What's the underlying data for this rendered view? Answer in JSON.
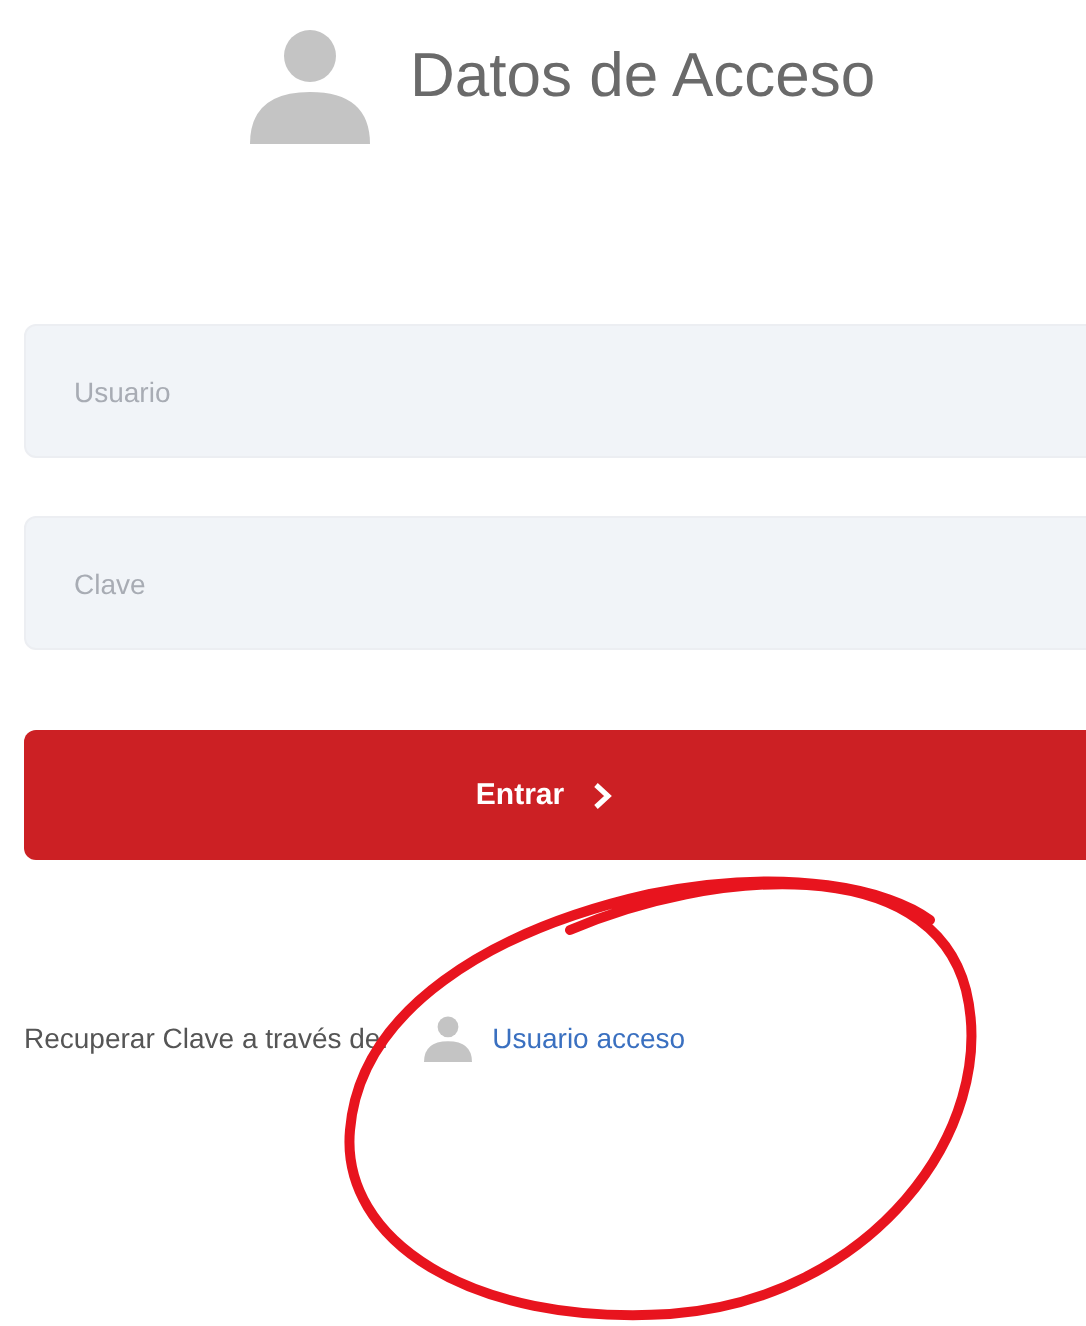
{
  "header": {
    "title": "Datos de Acceso"
  },
  "fields": [
    {
      "placeholder": "Usuario"
    },
    {
      "placeholder": "Clave"
    }
  ],
  "submit_button": {
    "label": "Entrar"
  },
  "recovery": {
    "label": "Recuperar Clave a través de:",
    "link": "Usuario acceso"
  }
}
